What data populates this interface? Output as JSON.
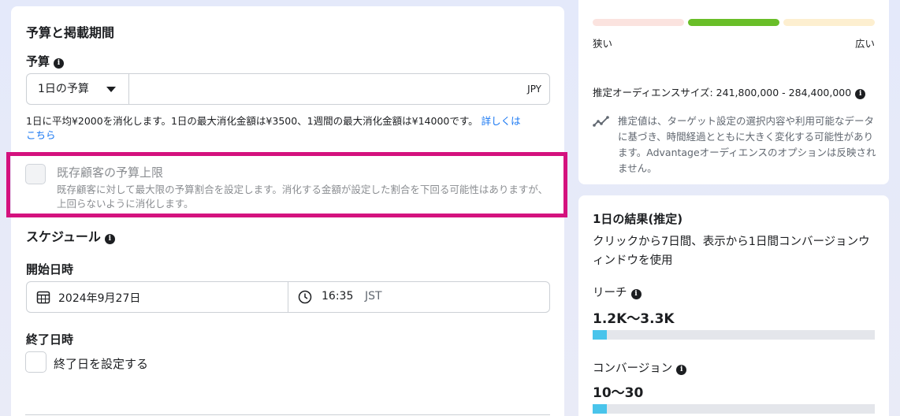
{
  "budget_section": {
    "title": "予算と掲載期間",
    "budget_label": "予算",
    "budget_type": "1日の予算",
    "budget_amount": "",
    "currency": "JPY",
    "help_line1": "1日に平均¥2000を消化します。1日の最大消化金額は¥3500、1週間の最大消化金額は¥14000です。",
    "help_link_part1": "詳しくは",
    "help_link_part2": "こちら",
    "existing_customer_cap": {
      "title": "既存顧客の予算上限",
      "desc": "既存顧客に対して最大限の予算割合を設定します。消化する金額が設定した割合を下回る可能性はありますが、上回らないように消化します。",
      "checked": false,
      "disabled": true
    }
  },
  "schedule": {
    "title": "スケジュール",
    "start_label": "開始日時",
    "start_date": "2024年9月27日",
    "start_time": "16:35",
    "timezone": "JST",
    "end_label": "終了日時",
    "end_checkbox_label": "終了日を設定する",
    "end_checked": false
  },
  "audience": {
    "narrow_label": "狭い",
    "wide_label": "広い",
    "meter_colors": [
      "#fbe3df",
      "#69be28",
      "#fdefd0"
    ],
    "size_text": "推定オーディエンスサイズ: 241,800,000 - 284,400,000",
    "estimate_note": "推定値は、ターゲット設定の選択内容や利用可能なデータに基づき、時間経過とともに大きく変化する可能性があります。Advantageオーディエンスのオプションは反映されません。"
  },
  "daily_results": {
    "title": "1日の結果(推定)",
    "desc": "クリックから7日間、表示から1日間コンバージョンウィンドウを使用",
    "reach_label": "リーチ",
    "reach_value": "1.2K〜3.3K",
    "reach_fill": 0.05,
    "conversion_label": "コンバージョン",
    "conversion_value": "10〜30",
    "conversion_fill": 0.05,
    "bar_color": "#49c4eb"
  }
}
